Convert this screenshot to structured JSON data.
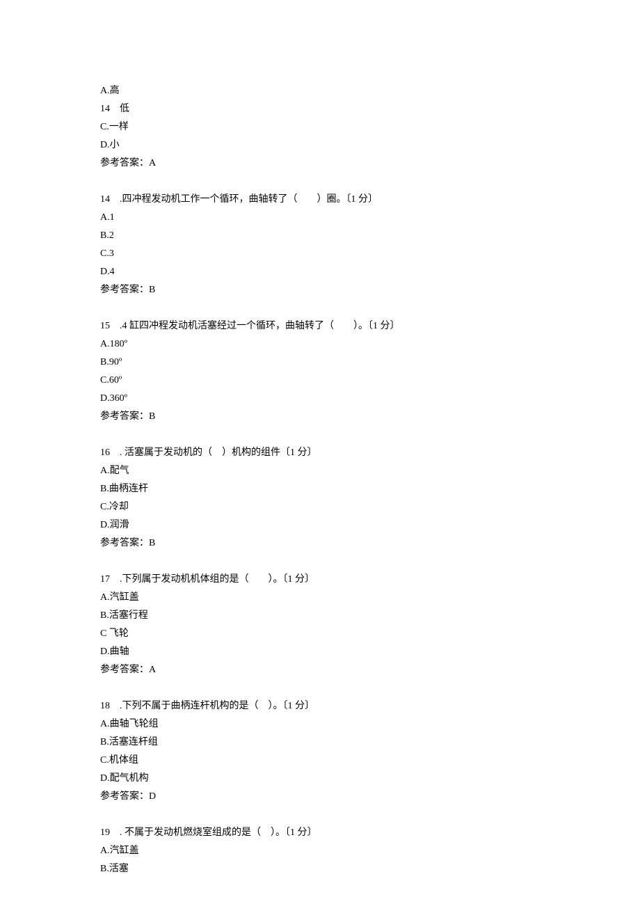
{
  "q13_fragment": {
    "options": {
      "a": "A.高",
      "b": "14　低",
      "c": "C.一样",
      "d": "D.小"
    },
    "answer": "参考答案：A"
  },
  "q14": {
    "stem": "14　.四冲程发动机工作一个循环，曲轴转了（　　）圈。〔1 分〕",
    "options": {
      "a": "A.1",
      "b": "B.2",
      "c": "C.3",
      "d": "D.4"
    },
    "answer": "参考答案：B"
  },
  "q15": {
    "stem": "15　.4 缸四冲程发动机活塞经过一个循环，曲轴转了（　　）。〔1 分〕",
    "options": {
      "a": "A.180º",
      "b": "B.90º",
      "c": "C.60º",
      "d": "D.360º"
    },
    "answer": "参考答案：B"
  },
  "q16": {
    "stem": "16　. 活塞属于发动机的（　）机构的组件〔1 分〕",
    "options": {
      "a": "A.配气",
      "b": "B.曲柄连杆",
      "c": "C.冷却",
      "d": "D.润滑"
    },
    "answer": "参考答案：B"
  },
  "q17": {
    "stem": "17　.下列属于发动机机体组的是（　　）。〔1 分〕",
    "options": {
      "a": "A.汽缸盖",
      "b": "B.活塞行程",
      "c": "C 飞轮",
      "d": "D.曲轴"
    },
    "answer": "参考答案：A"
  },
  "q18": {
    "stem": "18　.下列不属于曲柄连杆机构的是（　）。〔1 分〕",
    "options": {
      "a": "A.曲轴飞轮组",
      "b": "B.活塞连杆组",
      "c": "C.机体组",
      "d": "D.配气机构"
    },
    "answer": "参考答案：D"
  },
  "q19": {
    "stem": "19　. 不属于发动机燃烧室组成的是（　）。〔1 分〕",
    "options": {
      "a": "A.汽缸盖",
      "b": "B.活塞"
    }
  }
}
